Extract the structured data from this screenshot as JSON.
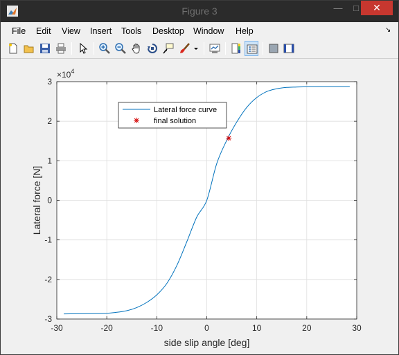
{
  "window": {
    "title": "Figure 3",
    "minimize_icon": "minimize-icon",
    "maximize_icon": "maximize-icon",
    "close_icon": "close-icon",
    "app_icon": "matlab-icon"
  },
  "menu": {
    "items": [
      "File",
      "Edit",
      "View",
      "Insert",
      "Tools",
      "Desktop",
      "Window",
      "Help"
    ]
  },
  "toolbar": {
    "buttons": [
      "new-figure-icon",
      "open-file-icon",
      "save-icon",
      "print-icon",
      "pointer-icon",
      "zoom-in-icon",
      "zoom-out-icon",
      "pan-icon",
      "rotate-icon",
      "data-cursor-icon",
      "brush-icon",
      "dropdown-arrow-icon",
      "link-plot-icon",
      "colorbar-icon",
      "legend-icon",
      "hide-plot-tools-icon",
      "show-plot-tools-icon"
    ]
  },
  "chart_data": {
    "type": "line",
    "title": "",
    "xlabel": "side slip angle [deg]",
    "ylabel": "Lateral force [N]",
    "exponent_label": "×10",
    "exponent_power": "4",
    "xlim": [
      -30,
      30
    ],
    "ylim": [
      -3,
      3
    ],
    "xticks": [
      "-30",
      "-20",
      "-10",
      "0",
      "10",
      "20",
      "30"
    ],
    "yticks": [
      "-3",
      "-2",
      "-1",
      "0",
      "1",
      "2",
      "3"
    ],
    "grid": true,
    "legend_placement": "upper-left",
    "series": [
      {
        "name": "Lateral force curve",
        "color": "#0072bd",
        "x": [
          -28.6,
          -24,
          -20,
          -18,
          -16,
          -14,
          -12,
          -10,
          -8,
          -6,
          -4,
          -2,
          0,
          2,
          4,
          6,
          8,
          10,
          12,
          14,
          16,
          18,
          20,
          24,
          28.6
        ],
        "y": [
          -2.87,
          -2.865,
          -2.855,
          -2.83,
          -2.79,
          -2.71,
          -2.58,
          -2.39,
          -2.1,
          -1.65,
          -1.05,
          -0.42,
          0.0,
          0.93,
          1.52,
          1.98,
          2.35,
          2.6,
          2.75,
          2.82,
          2.855,
          2.865,
          2.87,
          2.872,
          2.872
        ]
      },
      {
        "name": "final solution",
        "color": "#d40000",
        "marker": "asterisk",
        "x": [
          4.4
        ],
        "y": [
          1.57
        ]
      }
    ]
  }
}
